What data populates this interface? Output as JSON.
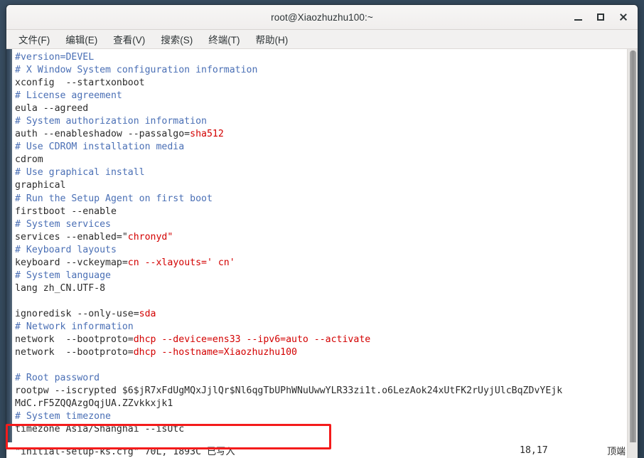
{
  "window": {
    "title": "root@Xiaozhuzhu100:~",
    "controls": {
      "minimize_label": "–",
      "maximize_label": "□",
      "close_label": "✕"
    }
  },
  "menubar": {
    "items": [
      {
        "label": "文件(F)"
      },
      {
        "label": "编辑(E)"
      },
      {
        "label": "查看(V)"
      },
      {
        "label": "搜索(S)"
      },
      {
        "label": "终端(T)"
      },
      {
        "label": "帮助(H)"
      }
    ]
  },
  "colors": {
    "comment": "#4a6fb5",
    "plain": "#2b2b2b",
    "value": "#d30000",
    "annotation": "#f41b1b",
    "desktop": "#36495c",
    "terminal_bg": "#ffffff",
    "chrome": "#f2f1f0"
  },
  "terminal": {
    "lines": [
      [
        {
          "t": "#version=DEVEL",
          "c": "comment"
        }
      ],
      [
        {
          "t": "# X Window System configuration information",
          "c": "comment"
        }
      ],
      [
        {
          "t": "xconfig  --startxonboot",
          "c": "plain"
        }
      ],
      [
        {
          "t": "# License agreement",
          "c": "comment"
        }
      ],
      [
        {
          "t": "eula --agreed",
          "c": "plain"
        }
      ],
      [
        {
          "t": "# System authorization information",
          "c": "comment"
        }
      ],
      [
        {
          "t": "auth --enableshadow --passalgo=",
          "c": "plain"
        },
        {
          "t": "sha512",
          "c": "value"
        }
      ],
      [
        {
          "t": "# Use CDROM installation media",
          "c": "comment"
        }
      ],
      [
        {
          "t": "cdrom",
          "c": "plain"
        }
      ],
      [
        {
          "t": "# Use graphical install",
          "c": "comment"
        }
      ],
      [
        {
          "t": "graphical",
          "c": "plain"
        }
      ],
      [
        {
          "t": "# Run the Setup Agent on first boot",
          "c": "comment"
        }
      ],
      [
        {
          "t": "firstboot --enable",
          "c": "plain"
        }
      ],
      [
        {
          "t": "# System services",
          "c": "comment"
        }
      ],
      [
        {
          "t": "services --enabled=\"",
          "c": "plain"
        },
        {
          "t": "chronyd\"",
          "c": "value"
        }
      ],
      [
        {
          "t": "# Keyboard layouts",
          "c": "comment"
        }
      ],
      [
        {
          "t": "keyboard --vckeymap=",
          "c": "plain"
        },
        {
          "t": "cn --xlayouts=' cn'",
          "c": "value"
        }
      ],
      [
        {
          "t": "# System language",
          "c": "comment"
        }
      ],
      [
        {
          "t": "lang zh_CN.UTF-8",
          "c": "plain"
        }
      ],
      [
        {
          "t": "",
          "c": "plain"
        }
      ],
      [
        {
          "t": "ignoredisk --only-use=",
          "c": "plain"
        },
        {
          "t": "sda",
          "c": "value"
        }
      ],
      [
        {
          "t": "# Network information",
          "c": "comment"
        }
      ],
      [
        {
          "t": "network  --bootproto=",
          "c": "plain"
        },
        {
          "t": "dhcp --device=ens33 --ipv6=auto --activate",
          "c": "value"
        }
      ],
      [
        {
          "t": "network  --bootproto=",
          "c": "plain"
        },
        {
          "t": "dhcp --hostname=Xiaozhuzhu100",
          "c": "value"
        }
      ],
      [
        {
          "t": "",
          "c": "plain"
        }
      ],
      [
        {
          "t": "# Root password",
          "c": "comment"
        }
      ],
      [
        {
          "t": "rootpw --iscrypted $6$jR7xFdUgMQxJjlQr$Nl6qgTbUPhWNuUwwYLR33zi1t.o6LezAok24xUtFK2rUyjUlcBqZDvYEjk",
          "c": "plain"
        }
      ],
      [
        {
          "t": "MdC.rF5ZQQAzgOqjUA.ZZvkkxjk1",
          "c": "plain"
        }
      ],
      [
        {
          "t": "# System timezone",
          "c": "comment"
        }
      ],
      [
        {
          "t": "timezone Asia/Shanghai --isUtc",
          "c": "plain"
        }
      ]
    ]
  },
  "statusbar": {
    "file_message": "\"initial-setup-ks.cfg\" 70L, 1893C 已写入",
    "cursor_position": "18,17",
    "scroll_state": "顶端"
  }
}
